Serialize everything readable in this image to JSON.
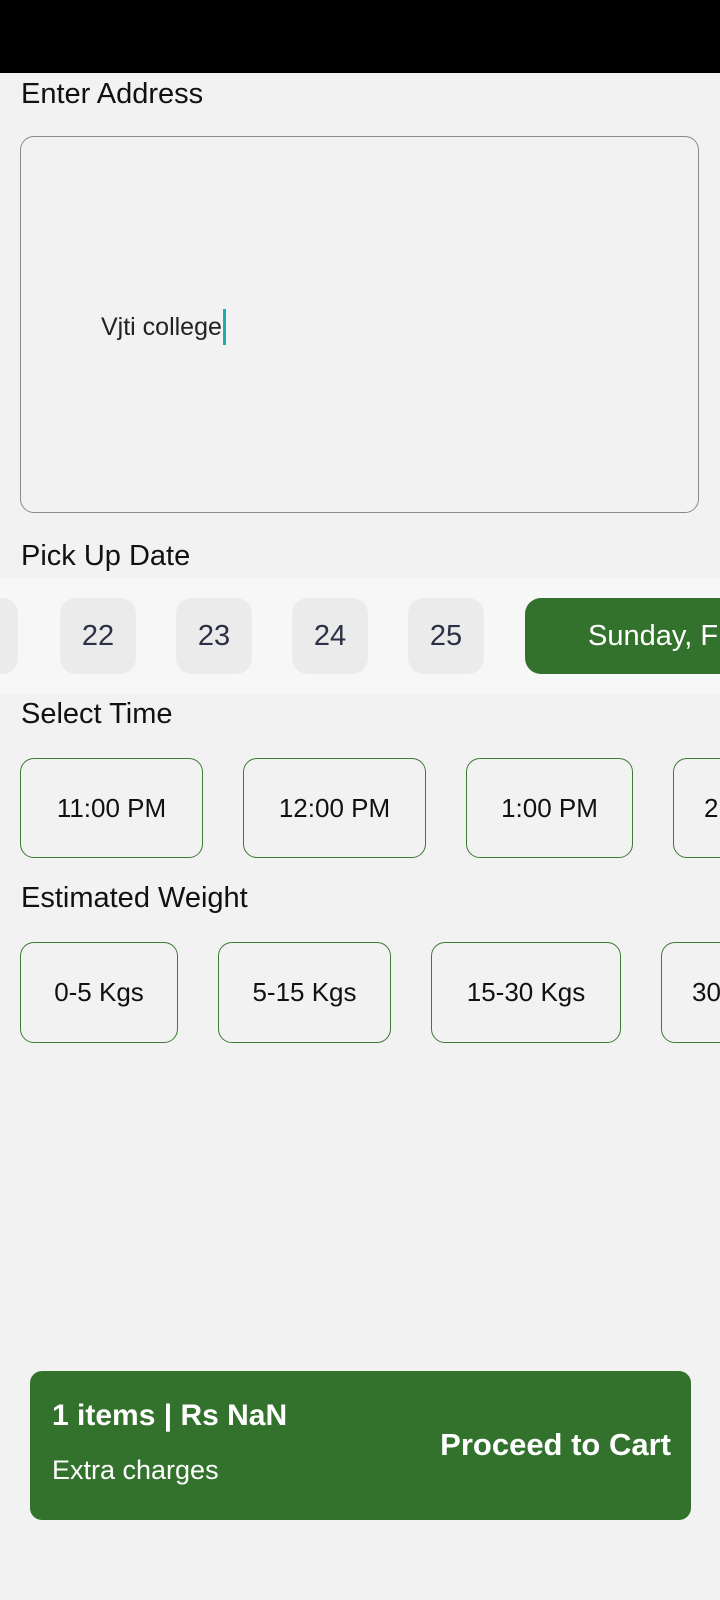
{
  "address": {
    "title": "Enter Address",
    "value": "Vjti college"
  },
  "pickup": {
    "title": "Pick Up Date",
    "dates": [
      "22",
      "23",
      "24",
      "25"
    ],
    "selected_label": "Sunday, F"
  },
  "time": {
    "title": "Select Time",
    "slots": [
      "11:00 PM",
      "12:00 PM",
      "1:00 PM",
      "2"
    ]
  },
  "weight": {
    "title": "Estimated Weight",
    "options": [
      "0-5 Kgs",
      "5-15 Kgs",
      "15-30 Kgs",
      "30"
    ]
  },
  "cart": {
    "summary": "1 items | Rs NaN",
    "extra": "Extra charges",
    "proceed_label": "Proceed to Cart"
  },
  "colors": {
    "accent": "#33722d",
    "caret": "#1bb0a8"
  }
}
